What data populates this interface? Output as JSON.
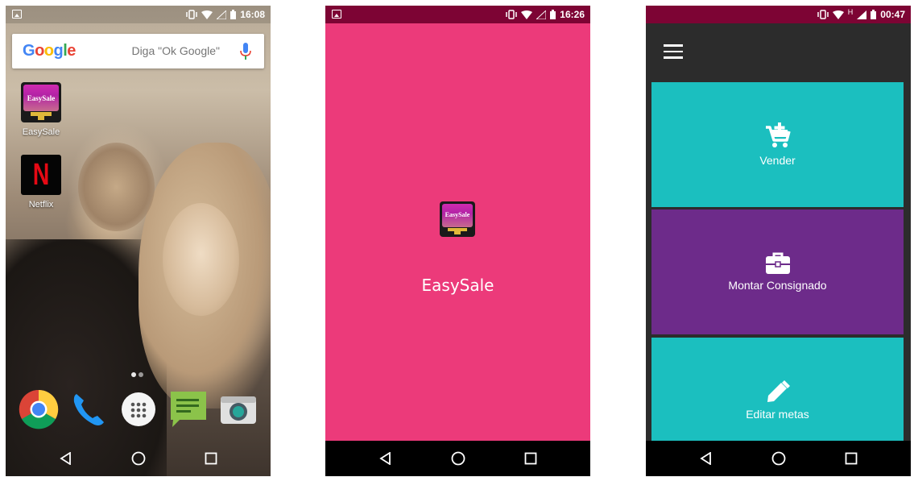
{
  "screens": [
    {
      "status_time": "16:08",
      "search": {
        "logo": [
          "G",
          "o",
          "o",
          "g",
          "l",
          "e"
        ],
        "hint": "Diga \"Ok Google\""
      },
      "apps": [
        {
          "label": "EasySale",
          "icon_text": "EasySale",
          "icon": "easysale-icon"
        },
        {
          "label": "Netflix",
          "icon_text": "N",
          "icon": "netflix-icon"
        }
      ],
      "dock": [
        "chrome-icon",
        "phone-icon",
        "app-drawer-icon",
        "messages-icon",
        "camera-icon"
      ]
    },
    {
      "status_time": "16:26",
      "splash": {
        "icon_text": "EasySale",
        "title": "EasySale"
      }
    },
    {
      "status_time": "00:47",
      "network_label": "H",
      "tiles": [
        {
          "label": "Vender",
          "icon": "cart-add-icon",
          "color": "#1bbfbf"
        },
        {
          "label": "Montar Consignado",
          "icon": "briefcase-icon",
          "color": "#6d2b8a"
        },
        {
          "label": "Editar metas",
          "icon": "pencil-icon",
          "color": "#1bbfbf"
        }
      ]
    }
  ],
  "colors": {
    "splash_bg": "#ec3a7a",
    "status_dark": "#7d0434",
    "menu_bg": "#2c2c2c"
  }
}
